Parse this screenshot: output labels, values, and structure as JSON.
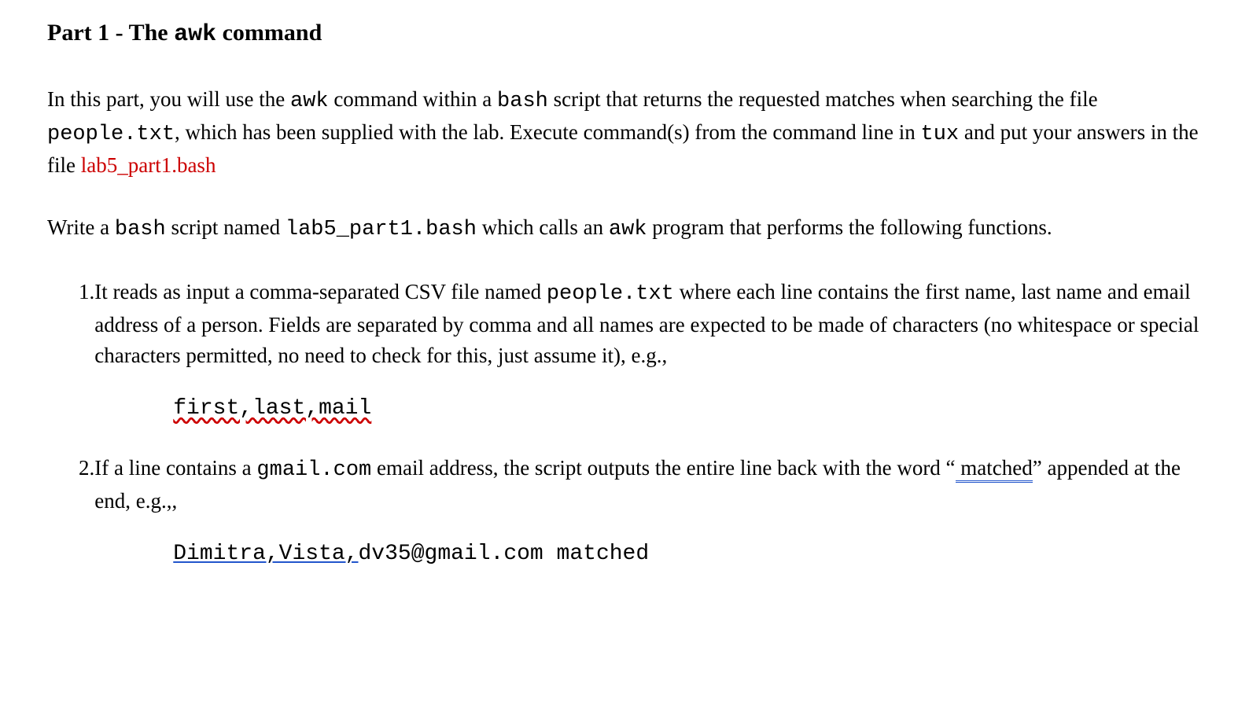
{
  "heading": {
    "prefix": "Part 1 - The ",
    "command": "awk",
    "suffix": " command"
  },
  "para1": {
    "t1": "In this part, you will use the ",
    "c1": "awk",
    "t2": " command within a ",
    "c2": "bash",
    "t3": " script that returns the requested matches when searching the file ",
    "c3": "people.txt",
    "t4": ", which has been supplied with the lab. Execute command(s) from the command line in ",
    "c4": "tux",
    "t5": " and put your answers in the file ",
    "red": "lab5_part1.bash"
  },
  "para2": {
    "t1": "Write a ",
    "c1": "bash",
    "t2": " script named ",
    "c2": "lab5_part1.bash",
    "t3": " which calls an ",
    "c3": "awk",
    "t4": " program that performs the following functions."
  },
  "item1": {
    "num": "1.",
    "t1": "It reads as input a comma-separated CSV file named ",
    "c1": "people.txt",
    "t2": " where each line contains the first name, last name and email address of a person. Fields are separated by comma and all names are expected to be made of characters (no whitespace or special characters permitted, no need to check for this, just assume it), e.g.,",
    "code": "first,last,mail"
  },
  "item2": {
    "num": "2.",
    "t1": "If a line contains a ",
    "c1": "gmail.com",
    "t2": " email address, the script outputs the entire line back with the word “",
    "matched": " matched",
    "t3": "” appended at the end, e.g.,,",
    "code_underlined": "Dimitra,Vista,",
    "code_rest": "dv35@gmail.com matched"
  }
}
